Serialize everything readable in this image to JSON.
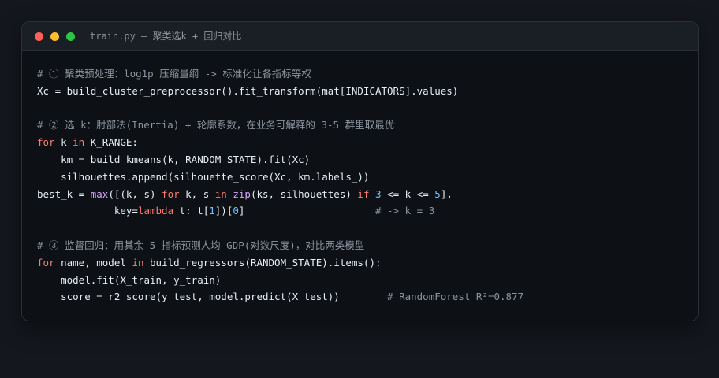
{
  "window": {
    "title": "train.py — 聚类选k + 回归对比",
    "controls": [
      {
        "name": "close",
        "color": "#ff5f57"
      },
      {
        "name": "minimize",
        "color": "#febc2e"
      },
      {
        "name": "maximize",
        "color": "#28c840"
      }
    ]
  },
  "colors": {
    "comment": "#8b949e",
    "keyword": "#ff7b72",
    "builtin": "#d2a8ff",
    "number": "#79c0ff",
    "plain": "#e6edf3"
  },
  "code": {
    "language": "python",
    "lines": [
      [
        [
          "cm",
          "# ① 聚类预处理：log1p 压缩量纲 -> 标准化让各指标等权"
        ]
      ],
      [
        [
          "pl",
          "Xc = build_cluster_preprocessor().fit_transform(mat[INDICATORS].values)"
        ]
      ],
      [],
      [
        [
          "cm",
          "# ② 选 k：肘部法(Inertia) + 轮廓系数，在业务可解释的 3-5 群里取最优"
        ]
      ],
      [
        [
          "kw",
          "for"
        ],
        [
          "pl",
          " k "
        ],
        [
          "kw",
          "in"
        ],
        [
          "pl",
          " K_RANGE:"
        ]
      ],
      [
        [
          "pl",
          "    km = build_kmeans(k, RANDOM_STATE).fit(Xc)"
        ]
      ],
      [
        [
          "pl",
          "    silhouettes.append(silhouette_score(Xc, km.labels_))"
        ]
      ],
      [
        [
          "pl",
          "best_k = "
        ],
        [
          "fn",
          "max"
        ],
        [
          "pl",
          "([(k, s) "
        ],
        [
          "kw",
          "for"
        ],
        [
          "pl",
          " k, s "
        ],
        [
          "kw",
          "in"
        ],
        [
          "pl",
          " "
        ],
        [
          "fn",
          "zip"
        ],
        [
          "pl",
          "(ks, silhouettes) "
        ],
        [
          "kw",
          "if"
        ],
        [
          "pl",
          " "
        ],
        [
          "num",
          "3"
        ],
        [
          "pl",
          " <= k <= "
        ],
        [
          "num",
          "5"
        ],
        [
          "pl",
          "],"
        ]
      ],
      [
        [
          "pl",
          "             key="
        ],
        [
          "kw",
          "lambda"
        ],
        [
          "pl",
          " t: t["
        ],
        [
          "num",
          "1"
        ],
        [
          "pl",
          "])["
        ],
        [
          "num",
          "0"
        ],
        [
          "pl",
          "]                      "
        ],
        [
          "cm",
          "# -> k = 3"
        ]
      ],
      [],
      [
        [
          "cm",
          "# ③ 监督回归：用其余 5 指标预测人均 GDP(对数尺度)，对比两类模型"
        ]
      ],
      [
        [
          "kw",
          "for"
        ],
        [
          "pl",
          " name, model "
        ],
        [
          "kw",
          "in"
        ],
        [
          "pl",
          " build_regressors(RANDOM_STATE).items():"
        ]
      ],
      [
        [
          "pl",
          "    model.fit(X_train, y_train)"
        ]
      ],
      [
        [
          "pl",
          "    score = r2_score(y_test, model.predict(X_test))        "
        ],
        [
          "cm",
          "# RandomForest R²=0.877"
        ]
      ]
    ]
  }
}
